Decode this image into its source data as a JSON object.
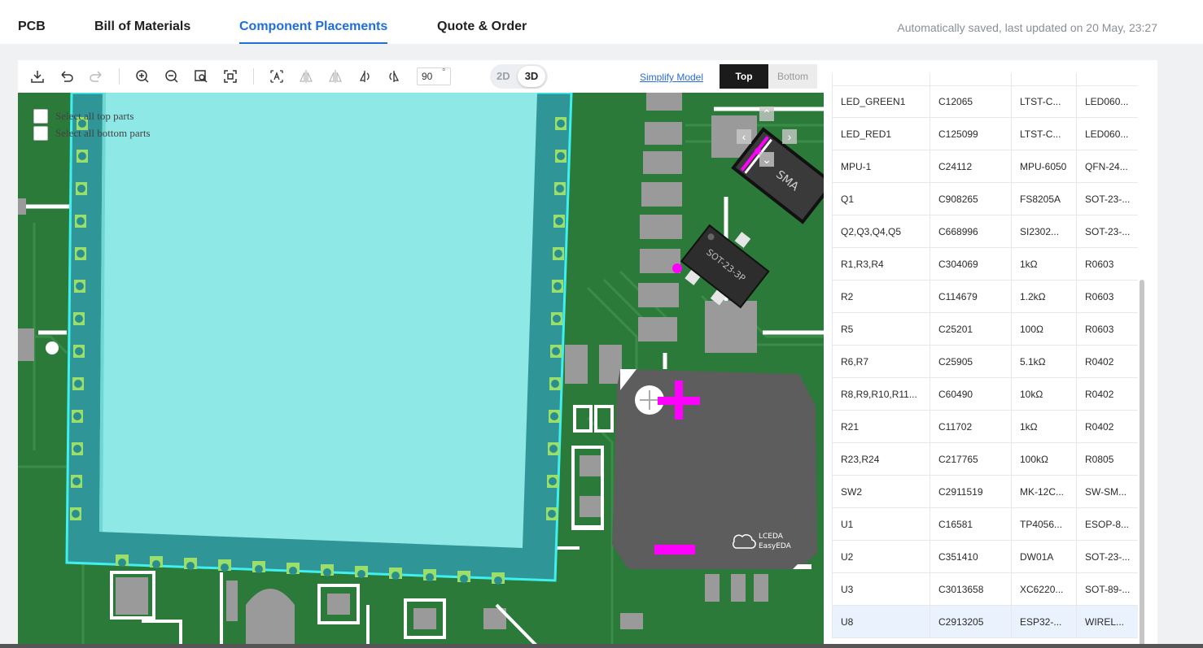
{
  "nav": {
    "tabs": [
      {
        "label": "PCB"
      },
      {
        "label": "Bill of Materials"
      },
      {
        "label": "Component Placements"
      },
      {
        "label": "Quote & Order"
      }
    ],
    "autosave_text": "Automatically saved, last updated on 20 May, 23:27"
  },
  "toolbar": {
    "rotation_value": "90",
    "rotation_unit": "°",
    "mode_2d": "2D",
    "mode_3d": "3D",
    "simplify_label": "Simplify Model",
    "side_top": "Top",
    "side_bottom": "Bottom"
  },
  "canvas": {
    "select_top_label": "Select all top parts",
    "select_bottom_label": "Select all bottom parts",
    "package_sma": "SMA",
    "package_sot": "SOT-23-3P",
    "logo_line1": "LCEDA",
    "logo_line2": "EasyEDA",
    "plus_symbol": "+"
  },
  "colors": {
    "accent": "#1e6fd9",
    "board_green": "#2b7a3a",
    "module_cyan": "#8ee8e6",
    "marker_magenta": "#ff00ff"
  },
  "table": {
    "rows": [
      {
        "designator": "LED_GREEN1",
        "lcsc": "C12065",
        "value": "LTST-C...",
        "footprint": "LED060..."
      },
      {
        "designator": "LED_RED1",
        "lcsc": "C125099",
        "value": "LTST-C...",
        "footprint": "LED060..."
      },
      {
        "designator": "MPU-1",
        "lcsc": "C24112",
        "value": "MPU-6050",
        "footprint": "QFN-24..."
      },
      {
        "designator": "Q1",
        "lcsc": "C908265",
        "value": "FS8205A",
        "footprint": "SOT-23-..."
      },
      {
        "designator": "Q2,Q3,Q4,Q5",
        "lcsc": "C668996",
        "value": "SI2302...",
        "footprint": "SOT-23-..."
      },
      {
        "designator": "R1,R3,R4",
        "lcsc": "C304069",
        "value": "1kΩ",
        "footprint": "R0603"
      },
      {
        "designator": "R2",
        "lcsc": "C114679",
        "value": "1.2kΩ",
        "footprint": "R0603"
      },
      {
        "designator": "R5",
        "lcsc": "C25201",
        "value": "100Ω",
        "footprint": "R0603"
      },
      {
        "designator": "R6,R7",
        "lcsc": "C25905",
        "value": "5.1kΩ",
        "footprint": "R0402"
      },
      {
        "designator": "R8,R9,R10,R11...",
        "lcsc": "C60490",
        "value": "10kΩ",
        "footprint": "R0402"
      },
      {
        "designator": "R21",
        "lcsc": "C11702",
        "value": "1kΩ",
        "footprint": "R0402"
      },
      {
        "designator": "R23,R24",
        "lcsc": "C217765",
        "value": "100kΩ",
        "footprint": "R0805"
      },
      {
        "designator": "SW2",
        "lcsc": "C2911519",
        "value": "MK-12C...",
        "footprint": "SW-SM..."
      },
      {
        "designator": "U1",
        "lcsc": "C16581",
        "value": "TP4056...",
        "footprint": "ESOP-8..."
      },
      {
        "designator": "U2",
        "lcsc": "C351410",
        "value": "DW01A",
        "footprint": "SOT-23-..."
      },
      {
        "designator": "U3",
        "lcsc": "C3013658",
        "value": "XC6220...",
        "footprint": "SOT-89-..."
      },
      {
        "designator": "U8",
        "lcsc": "C2913205",
        "value": "ESP32-...",
        "footprint": "WIREL..."
      }
    ]
  }
}
